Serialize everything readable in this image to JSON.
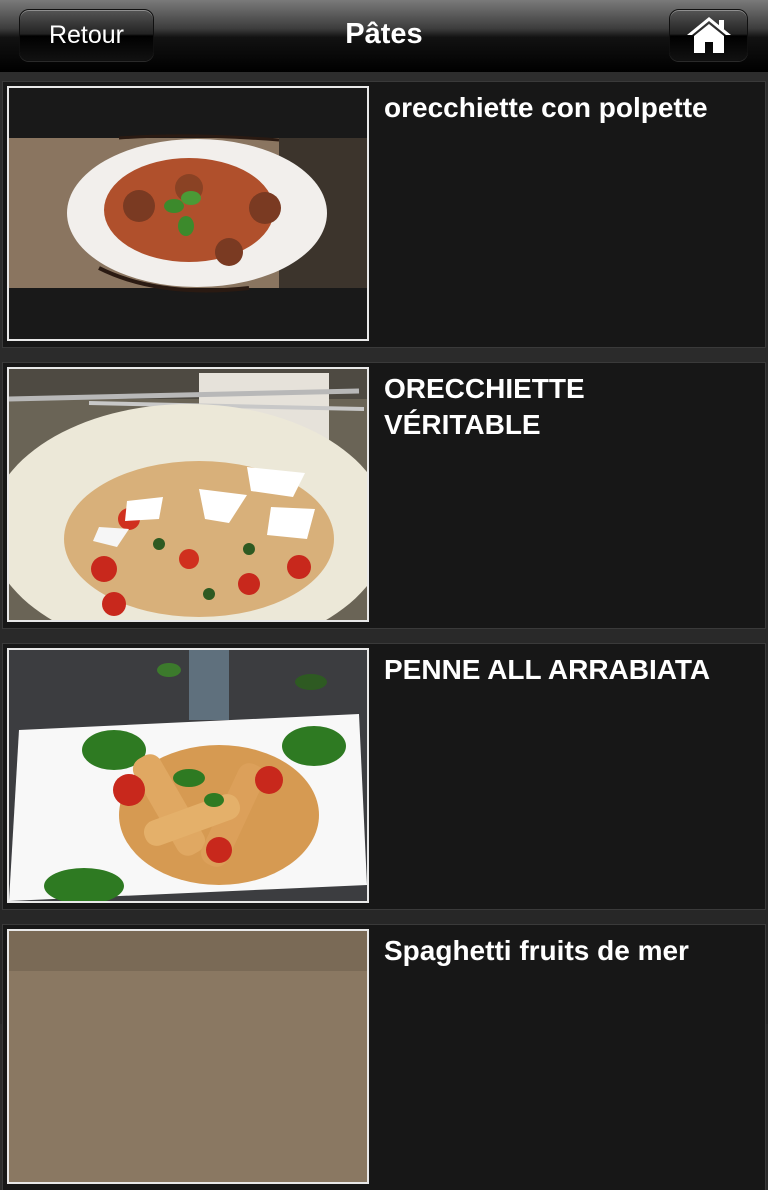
{
  "navbar": {
    "back_label": "Retour",
    "title": "Pâtes",
    "home_icon": "home-icon"
  },
  "dishes": [
    {
      "title": "orecchiette con polpette"
    },
    {
      "title": "ORECCHIETTE VÉRITABLE"
    },
    {
      "title": "PENNE ALL ARRABIATA"
    },
    {
      "title": "Spaghetti fruits de mer"
    }
  ]
}
